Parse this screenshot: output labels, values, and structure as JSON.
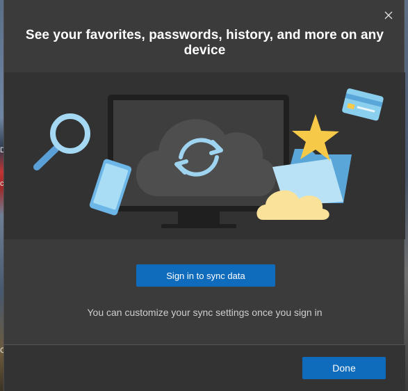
{
  "dialog": {
    "title": "See your favorites, passwords, history, and more on any device",
    "close_icon": "close-icon",
    "hero_icons": [
      "magnifier-icon",
      "phone-icon",
      "monitor-icon",
      "cloud-sync-icon",
      "star-icon",
      "credit-card-icon",
      "folder-icon",
      "cloud-icon"
    ],
    "sign_in_button_label": "Sign in to sync data",
    "subtext": "You can customize your sync settings once you sign in",
    "done_button_label": "Done"
  },
  "backdrop": {
    "left_edge_fragments": [
      "Da",
      "c",
      "C"
    ]
  },
  "colors": {
    "accent": "#0f6cbd",
    "dialog_bg": "#3b3b3b",
    "hero_bg": "#323232",
    "star": "#f7c948",
    "cloud_yellow": "#fbe29a",
    "device_blue": "#8fd0f0"
  }
}
